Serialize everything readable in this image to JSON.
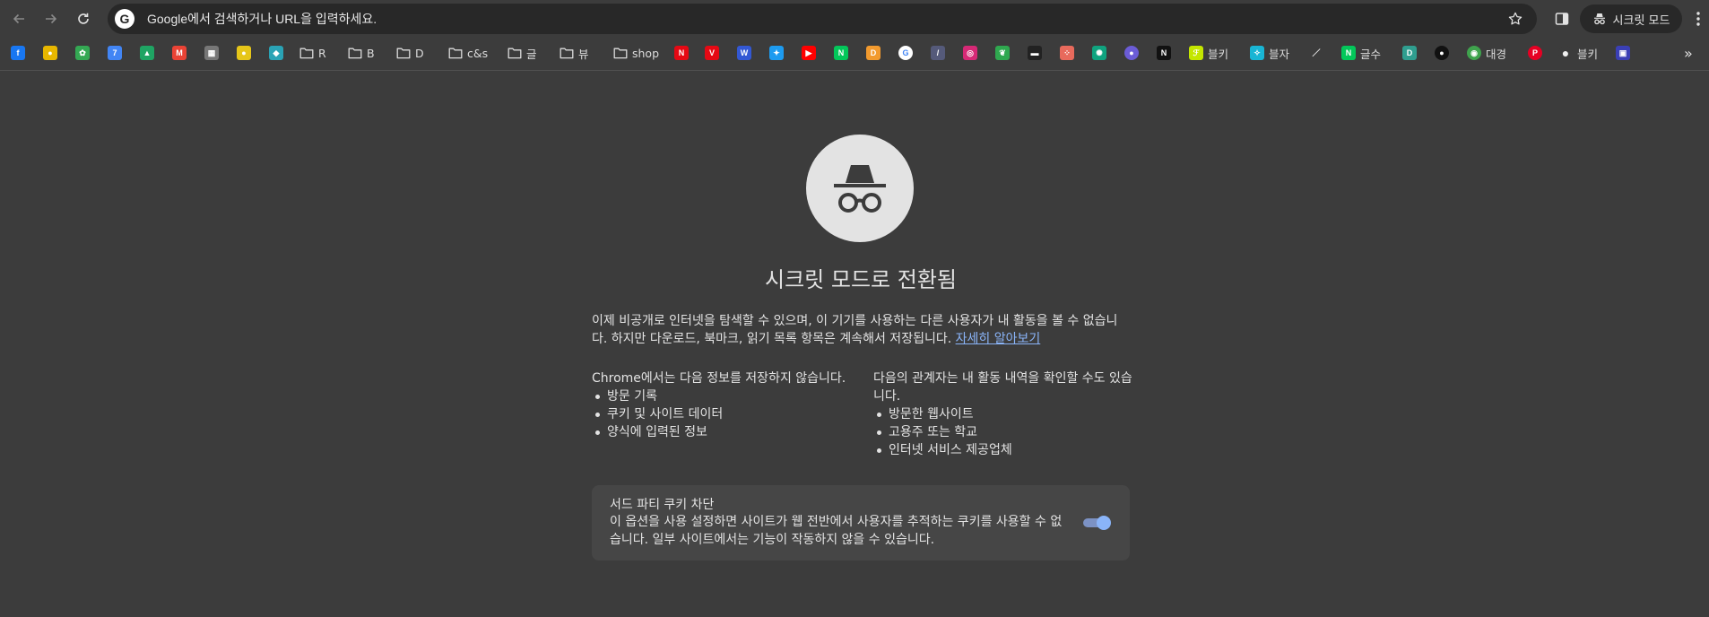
{
  "toolbar": {
    "omnibox_text": "Google에서 검색하거나 URL을 입력하세요.",
    "google_badge": "G",
    "incognito_label": "시크릿 모드"
  },
  "bookmarks": {
    "items": [
      {
        "icon": "facebook-icon",
        "glyph": "f",
        "color": "#1877f2",
        "label": ""
      },
      {
        "icon": "kakao-icon",
        "glyph": "●",
        "color": "#e8b700",
        "label": ""
      },
      {
        "icon": "photos-icon",
        "glyph": "✿",
        "color": "#34a853",
        "label": ""
      },
      {
        "icon": "calendar-icon",
        "glyph": "7",
        "color": "#4285f4",
        "label": ""
      },
      {
        "icon": "drive-icon",
        "glyph": "▲",
        "color": "#1fa463",
        "label": ""
      },
      {
        "icon": "gmail-icon",
        "glyph": "M",
        "color": "#ea4335",
        "label": ""
      },
      {
        "icon": "site-icon",
        "glyph": "▦",
        "color": "#777777",
        "label": ""
      },
      {
        "icon": "lemon-icon",
        "glyph": "●",
        "color": "#e6c619",
        "label": ""
      },
      {
        "icon": "app-icon",
        "glyph": "◆",
        "color": "#2aa3b5",
        "label": ""
      },
      {
        "icon": "folder-icon",
        "glyph": "",
        "color": "",
        "label": "R"
      },
      {
        "icon": "folder-icon",
        "glyph": "",
        "color": "",
        "label": "B"
      },
      {
        "icon": "folder-icon",
        "glyph": "",
        "color": "",
        "label": "D"
      },
      {
        "icon": "folder-icon",
        "glyph": "",
        "color": "",
        "label": "c&s"
      },
      {
        "icon": "folder-icon",
        "glyph": "",
        "color": "",
        "label": "글"
      },
      {
        "icon": "folder-icon",
        "glyph": "",
        "color": "",
        "label": "뷰"
      },
      {
        "icon": "folder-icon",
        "glyph": "",
        "color": "",
        "label": "shop"
      },
      {
        "icon": "netflix-icon",
        "glyph": "N",
        "color": "#e50914",
        "label": ""
      },
      {
        "icon": "site-icon",
        "glyph": "V",
        "color": "#e50914",
        "label": ""
      },
      {
        "icon": "site-icon",
        "glyph": "W",
        "color": "#3358d4",
        "label": ""
      },
      {
        "icon": "bird-icon",
        "glyph": "✦",
        "color": "#1d9bf0",
        "label": ""
      },
      {
        "icon": "youtube-icon",
        "glyph": "▶",
        "color": "#ff0000",
        "label": ""
      },
      {
        "icon": "naver-icon",
        "glyph": "N",
        "color": "#03c75a",
        "label": ""
      },
      {
        "icon": "site-icon",
        "glyph": "D",
        "color": "#f29a2e",
        "label": ""
      },
      {
        "icon": "google-icon",
        "glyph": "G",
        "color": "#4285f4",
        "label": ""
      },
      {
        "icon": "pen-icon",
        "glyph": "/",
        "color": "#555a7a",
        "label": ""
      },
      {
        "icon": "instagram-icon",
        "glyph": "◎",
        "color": "#d62976",
        "label": ""
      },
      {
        "icon": "leaf-icon",
        "glyph": "❦",
        "color": "#2fa84f",
        "label": ""
      },
      {
        "icon": "site-icon",
        "glyph": "▬",
        "color": "#222222",
        "label": ""
      },
      {
        "icon": "grid-icon",
        "glyph": "⁘",
        "color": "#e86a5c",
        "label": ""
      },
      {
        "icon": "chatgpt-icon",
        "glyph": "✺",
        "color": "#10a37f",
        "label": ""
      },
      {
        "icon": "site-icon",
        "glyph": "●",
        "color": "#6b5cd6",
        "label": ""
      },
      {
        "icon": "notion-icon",
        "glyph": "N",
        "color": "#111111",
        "label": ""
      },
      {
        "icon": "site-icon",
        "glyph": "ℱ",
        "color": "#c4e600",
        "label": "블키"
      },
      {
        "icon": "site-icon",
        "glyph": "✧",
        "color": "#19b5d4",
        "label": "블자"
      },
      {
        "icon": "slash-icon",
        "glyph": "／",
        "color": "#3c3c3c",
        "label": ""
      },
      {
        "icon": "naver-icon",
        "glyph": "N",
        "color": "#03c75a",
        "label": "글수"
      },
      {
        "icon": "site-icon",
        "glyph": "D",
        "color": "#2f9e8f",
        "label": ""
      },
      {
        "icon": "site-icon",
        "glyph": "●",
        "color": "#111111",
        "label": ""
      },
      {
        "icon": "globe-icon",
        "glyph": "◉",
        "color": "#3fa34d",
        "label": "대경"
      },
      {
        "icon": "pinterest-icon",
        "glyph": "P",
        "color": "#e60023",
        "label": ""
      },
      {
        "icon": "record-icon",
        "glyph": "●",
        "color": "#f0f0f0",
        "label": "블키"
      },
      {
        "icon": "site-icon",
        "glyph": "▣",
        "color": "#3a3fb5",
        "label": ""
      }
    ],
    "overflow": "»"
  },
  "incognito": {
    "title": "시크릿 모드로 전환됨",
    "intro": "이제 비공개로 인터넷을 탐색할 수 있으며, 이 기기를 사용하는 다른 사용자가 내 활동을 볼 수 없습니다. 하지만 다운로드, 북마크, 읽기 목록 항목은 계속해서 저장됩니다. ",
    "learn_more": "자세히 알아보기",
    "not_saved_heading": "Chrome에서는 다음 정보를 저장하지 않습니다.",
    "not_saved": [
      "방문 기록",
      "쿠키 및 사이트 데이터",
      "양식에 입력된 정보"
    ],
    "visible_heading": "다음의 관계자는 내 활동 내역을 확인할 수도 있습니다.",
    "visible_to": [
      "방문한 웹사이트",
      "고용주 또는 학교",
      "인터넷 서비스 제공업체"
    ],
    "cookie_title": "서드 파티 쿠키 차단",
    "cookie_desc": "이 옵션을 사용 설정하면 사이트가 웹 전반에서 사용자를 추적하는 쿠키를 사용할 수 없습니다. 일부 사이트에서는 기능이 작동하지 않을 수 있습니다.",
    "cookie_toggle_on": true
  }
}
